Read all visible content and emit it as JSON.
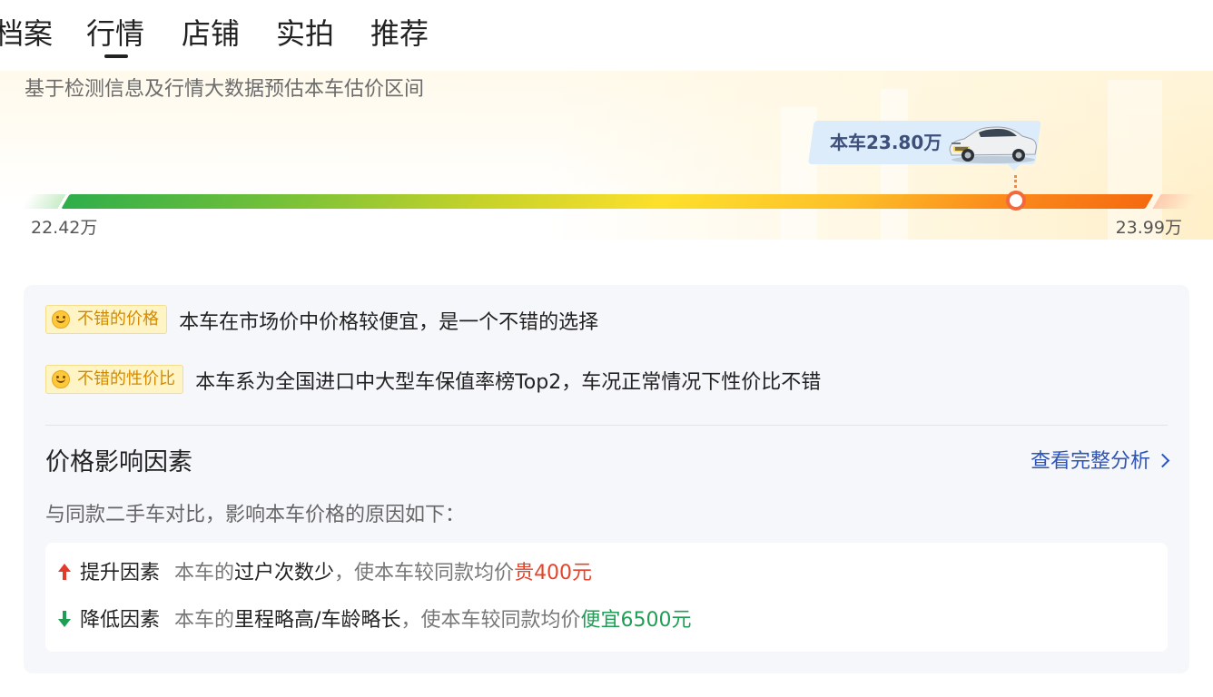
{
  "tabs": [
    {
      "label": "档案"
    },
    {
      "label": "行情"
    },
    {
      "label": "店铺"
    },
    {
      "label": "实拍"
    },
    {
      "label": "推荐"
    }
  ],
  "active_tab": "行情",
  "price_estimate": {
    "subtitle": "基于检测信息及行情大数据预估本车估价区间",
    "current_label": "本车23.80万",
    "min_label": "22.42万",
    "max_label": "23.99万",
    "min_value": 22.42,
    "max_value": 23.99,
    "current_value": 23.8
  },
  "evaluations": [
    {
      "badge": "不错的价格",
      "text": "本车在市场价中价格较便宜，是一个不错的选择"
    },
    {
      "badge": "不错的性价比",
      "text": "本车系为全国进口中大型车保值率榜Top2，车况正常情况下性价比不错"
    }
  ],
  "factors": {
    "title": "价格影响因素",
    "link_label": "查看完整分析",
    "description": "与同款二手车对比，影响本车价格的原因如下：",
    "up": {
      "label": "提升因素",
      "prefix": "本车的",
      "reason": "过户次数少",
      "middle": "，使本车较同款均价",
      "value": "贵400元"
    },
    "down": {
      "label": "降低因素",
      "prefix": "本车的",
      "reason": "里程略高/车龄略长",
      "middle": "，使本车较同款均价",
      "value": "便宜6500元"
    }
  },
  "colors": {
    "accent_blue": "#2f54b8",
    "up_red": "#e2452c",
    "down_green": "#1e9e55",
    "badge_orange": "#d38a00"
  }
}
